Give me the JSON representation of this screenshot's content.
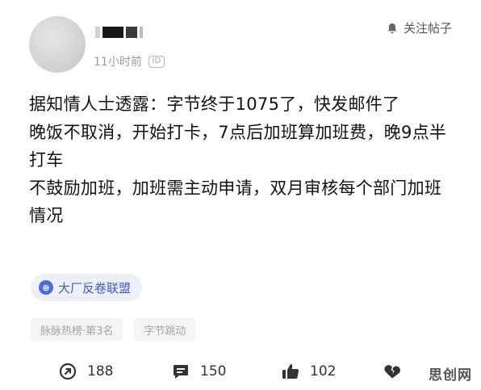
{
  "post": {
    "time": "11小时前",
    "id_badge": "ID",
    "follow_label": "关注帖子",
    "content_lines": [
      "据知情人士透露：字节终于1075了，快发邮件了",
      "晚饭不取消，开始打卡，7点后加班算加班费，晚9点半打车",
      "不鼓励加班，加班需主动申请，双月审核每个部门加班情况"
    ],
    "topic": "大厂反卷联盟",
    "topic_icon_glyph": "⊕",
    "tags": [
      "脉脉热榜·第3名",
      "字节跳动"
    ],
    "actions": {
      "share_count": "188",
      "comment_count": "150",
      "like_count": "102",
      "dislike_count": ""
    },
    "icons": [
      "bell-icon",
      "share-icon",
      "comment-icon",
      "thumbs-up-icon",
      "broken-heart-icon"
    ]
  },
  "watermark": "思创网"
}
